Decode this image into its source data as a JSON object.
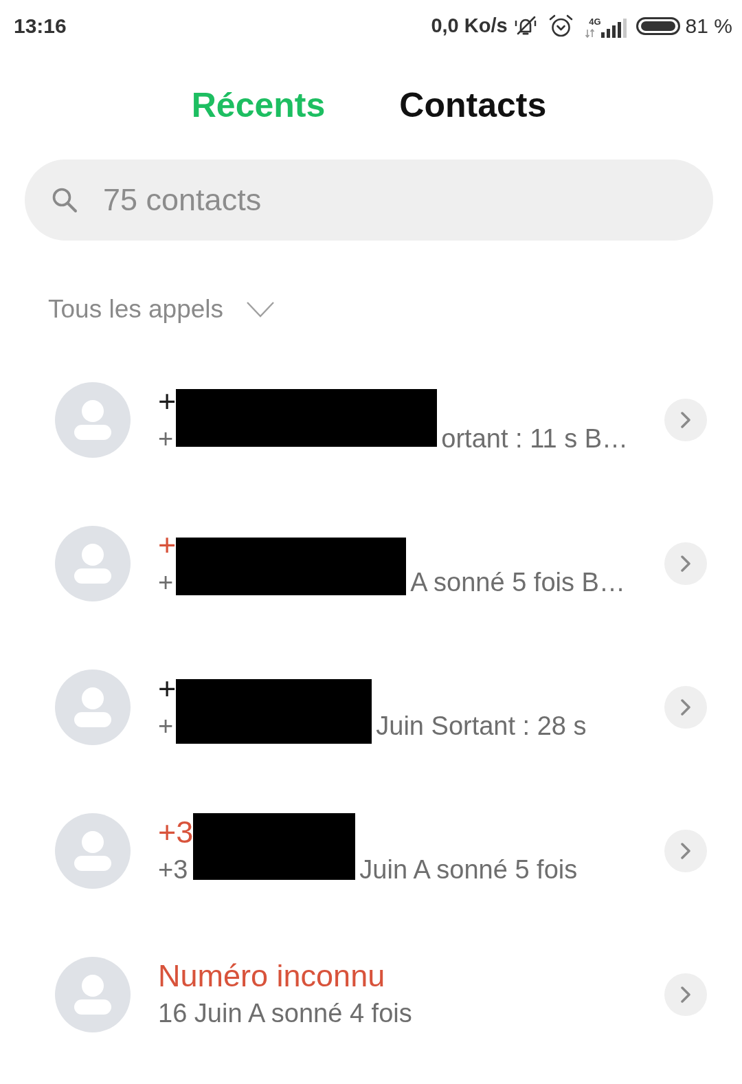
{
  "status_bar": {
    "time": "13:16",
    "network_speed": "0,0 Ko/s",
    "network_type": "4G",
    "battery": "81 %"
  },
  "tabs": [
    {
      "label": "Récents",
      "selected": true
    },
    {
      "label": "Contacts",
      "selected": false
    }
  ],
  "search": {
    "placeholder": "75 contacts"
  },
  "filter": {
    "label": "Tous les appels"
  },
  "calls": [
    {
      "name": "+",
      "missed": false,
      "detail": "+",
      "redacted": true,
      "detail_after_redaction": "ortant : 11 s B…"
    },
    {
      "name": "+",
      "missed": true,
      "detail": "+",
      "redacted": true,
      "detail_after_redaction": "A sonné 5 fois B…"
    },
    {
      "name": "+",
      "missed": false,
      "detail": "+",
      "redacted": true,
      "detail_after_redaction": "Juin Sortant : 28 s"
    },
    {
      "name": "+3",
      "missed": true,
      "detail": "+3",
      "redacted": true,
      "detail_after_redaction": "Juin A sonné 5 fois"
    },
    {
      "name": "Numéro inconnu",
      "missed": true,
      "detail": "16 Juin A sonné 4 fois",
      "redacted": false
    }
  ]
}
